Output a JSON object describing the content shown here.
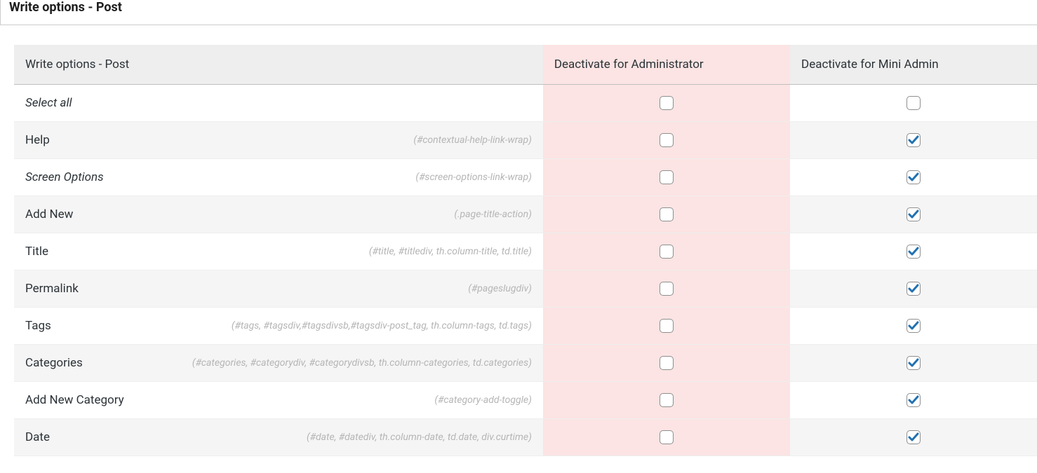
{
  "header": {
    "title": "Write options - Post"
  },
  "table": {
    "columns": {
      "option": "Write options - Post",
      "admin": "Deactivate for Administrator",
      "mini": "Deactivate for Mini Admin"
    },
    "rows": [
      {
        "label": "Select all",
        "selector": "",
        "italic": true,
        "admin_checked": false,
        "mini_checked": false
      },
      {
        "label": "Help",
        "selector": "(#contextual-help-link-wrap)",
        "italic": false,
        "admin_checked": false,
        "mini_checked": true
      },
      {
        "label": "Screen Options",
        "selector": "(#screen-options-link-wrap)",
        "italic": true,
        "admin_checked": false,
        "mini_checked": true
      },
      {
        "label": "Add New",
        "selector": "(.page-title-action)",
        "italic": false,
        "admin_checked": false,
        "mini_checked": true
      },
      {
        "label": "Title",
        "selector": "(#title, #titlediv, th.column-title, td.title)",
        "italic": false,
        "admin_checked": false,
        "mini_checked": true
      },
      {
        "label": "Permalink",
        "selector": "(#pageslugdiv)",
        "italic": false,
        "admin_checked": false,
        "mini_checked": true
      },
      {
        "label": "Tags",
        "selector": "(#tags, #tagsdiv,#tagsdivsb,#tagsdiv-post_tag, th.column-tags, td.tags)",
        "italic": false,
        "admin_checked": false,
        "mini_checked": true
      },
      {
        "label": "Categories",
        "selector": "(#categories, #categorydiv, #categorydivsb, th.column-categories, td.categories)",
        "italic": false,
        "admin_checked": false,
        "mini_checked": true
      },
      {
        "label": "Add New Category",
        "selector": "(#category-add-toggle)",
        "italic": false,
        "admin_checked": false,
        "mini_checked": true
      },
      {
        "label": "Date",
        "selector": "(#date, #datediv, th.column-date, td.date, div.curtime)",
        "italic": false,
        "admin_checked": false,
        "mini_checked": true
      }
    ]
  }
}
